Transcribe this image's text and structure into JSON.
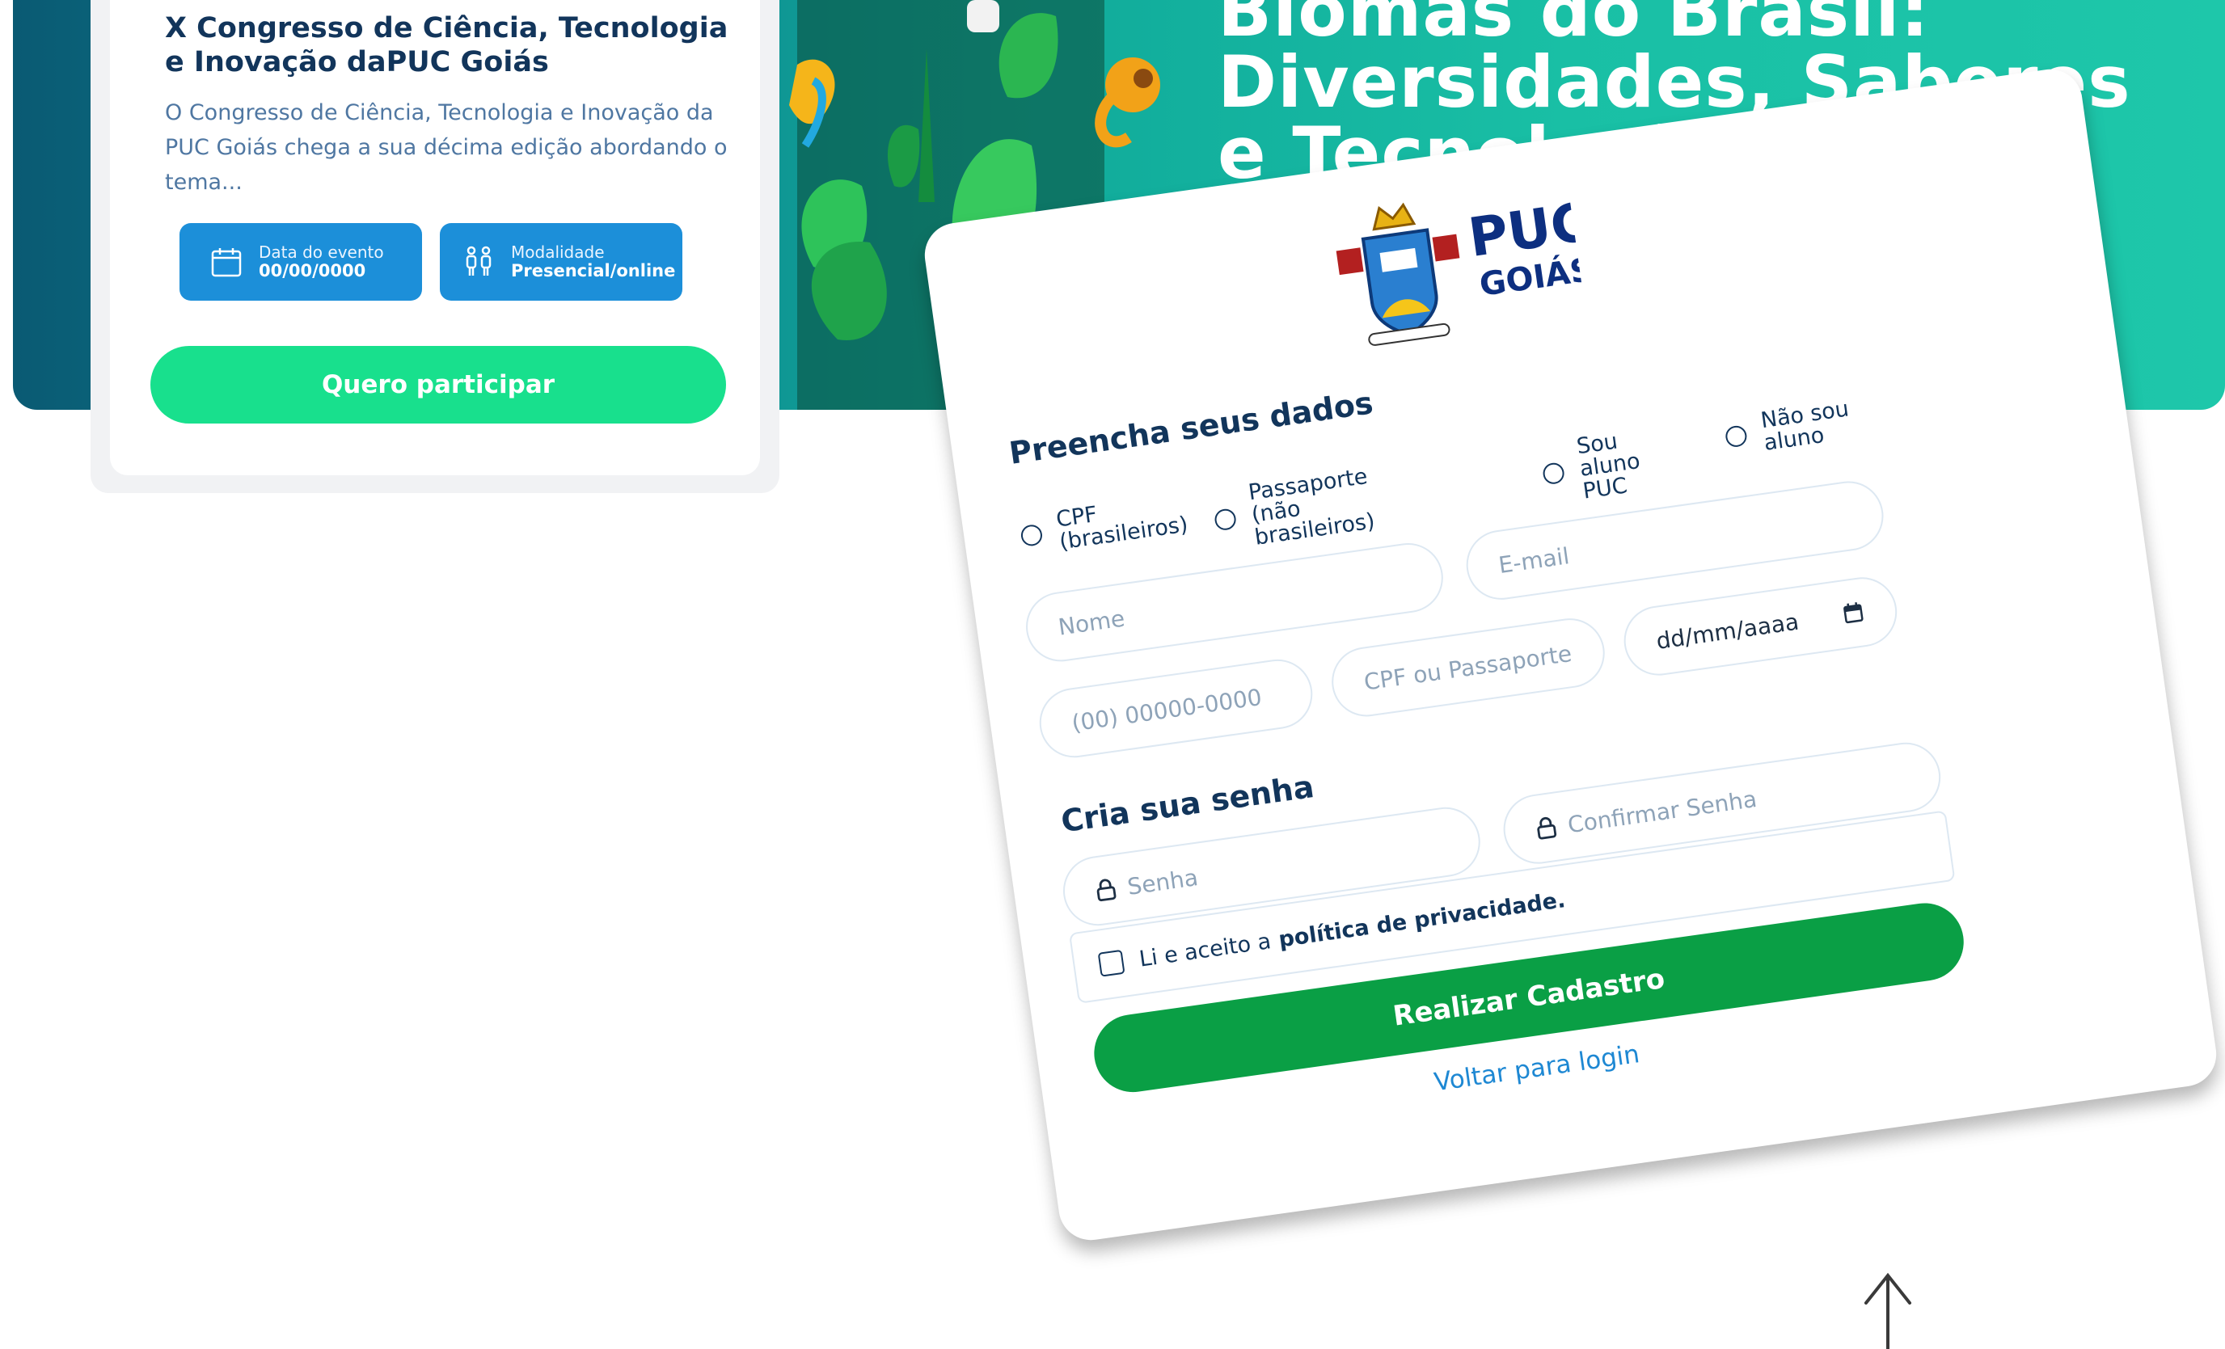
{
  "banner": {
    "title_lines": [
      "Biomas do Brasil:",
      "Diversidades, Saberes",
      "e Tecnologias"
    ]
  },
  "event": {
    "title": "X Congresso de Ciência, Tecnologia e Inovação daPUC Goiás",
    "description": "O Congresso de Ciência, Tecnologia e Inovação da PUC Goiás chega a sua décima edição abordando o tema...",
    "date_label": "Data do evento",
    "date_value": "00/00/0000",
    "mode_label": "Modalidade",
    "mode_value": "Presencial/online",
    "cta_label": "Quero participar"
  },
  "form": {
    "logo_line1": "PUC",
    "logo_line2": "GOIÁS",
    "heading_data": "Preencha seus dados",
    "doc_options": [
      "CPF (brasileiros)",
      "Passaporte (não brasileiros)"
    ],
    "student_options": [
      "Sou aluno PUC",
      "Não sou aluno"
    ],
    "name_placeholder": "Nome",
    "email_placeholder": "E-mail",
    "phone_placeholder": "(00) 00000-0000",
    "doc_placeholder": "CPF ou Passaporte",
    "birthdate_value": "dd/mm/aaaa",
    "heading_password": "Cria sua senha",
    "password_placeholder": "Senha",
    "confirm_placeholder": "Confirmar Senha",
    "privacy_text": "Li e aceito a",
    "privacy_link": "política de privacidade.",
    "submit_label": "Realizar Cadastro",
    "back_label": "Voltar para login"
  },
  "colors": {
    "navy": "#12355b",
    "banner_teal": "#10a99a",
    "cta_green": "#18e08d",
    "submit_green": "#0a9f45",
    "pill_blue": "#1c8fd9",
    "link_blue": "#1e88d3"
  }
}
